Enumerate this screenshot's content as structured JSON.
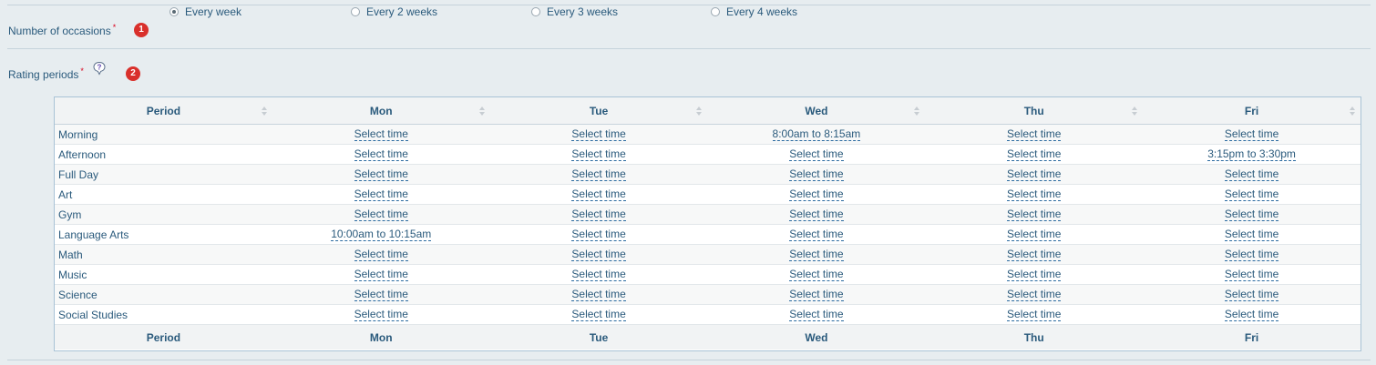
{
  "occasions": {
    "label": "Number of occasions",
    "required_mark": "*",
    "step_badge": "1",
    "options": [
      {
        "label": "Every week",
        "selected": true
      },
      {
        "label": "Every 2 weeks",
        "selected": false
      },
      {
        "label": "Every 3 weeks",
        "selected": false
      },
      {
        "label": "Every 4 weeks",
        "selected": false
      }
    ]
  },
  "rating": {
    "label": "Rating periods",
    "required_mark": "*",
    "step_badge": "2",
    "help_icon": "question-balloon-icon"
  },
  "table": {
    "columns": [
      "Period",
      "Mon",
      "Tue",
      "Wed",
      "Thu",
      "Fri"
    ],
    "rows": [
      {
        "period": "Morning",
        "times": [
          "Select time",
          "Select time",
          "8:00am to 8:15am",
          "Select time",
          "Select time"
        ]
      },
      {
        "period": "Afternoon",
        "times": [
          "Select time",
          "Select time",
          "Select time",
          "Select time",
          "3:15pm to 3:30pm"
        ]
      },
      {
        "period": "Full Day",
        "times": [
          "Select time",
          "Select time",
          "Select time",
          "Select time",
          "Select time"
        ]
      },
      {
        "period": "Art",
        "times": [
          "Select time",
          "Select time",
          "Select time",
          "Select time",
          "Select time"
        ]
      },
      {
        "period": "Gym",
        "times": [
          "Select time",
          "Select time",
          "Select time",
          "Select time",
          "Select time"
        ]
      },
      {
        "period": "Language Arts",
        "times": [
          "10:00am to 10:15am",
          "Select time",
          "Select time",
          "Select time",
          "Select time"
        ]
      },
      {
        "period": "Math",
        "times": [
          "Select time",
          "Select time",
          "Select time",
          "Select time",
          "Select time"
        ]
      },
      {
        "period": "Music",
        "times": [
          "Select time",
          "Select time",
          "Select time",
          "Select time",
          "Select time"
        ]
      },
      {
        "period": "Science",
        "times": [
          "Select time",
          "Select time",
          "Select time",
          "Select time",
          "Select time"
        ]
      },
      {
        "period": "Social Studies",
        "times": [
          "Select time",
          "Select time",
          "Select time",
          "Select time",
          "Select time"
        ]
      }
    ]
  },
  "colors": {
    "text": "#2a5a7c",
    "background": "#e7edf0",
    "badge": "#d9302b",
    "required": "#d9001b"
  }
}
